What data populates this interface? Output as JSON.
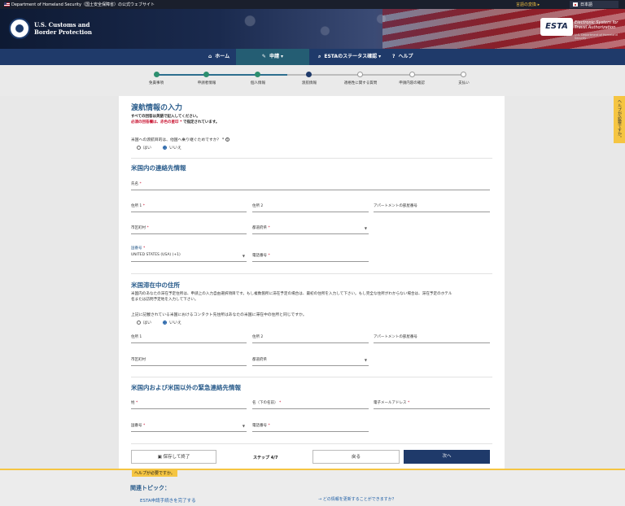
{
  "topbar": {
    "official": "Department of Homeland Security（国土安全保障省）の公式ウェブサイト",
    "change_language": "言語の変換 ▸",
    "language": "日本語"
  },
  "banner": {
    "agency_line1": "U.S. Customs and",
    "agency_line2": "Border Protection",
    "esta_logo": "ESTA",
    "esta_tagline1": "Electronic System for",
    "esta_tagline2": "Travel Authorization",
    "esta_dept": "U.S. Department of Homeland Security"
  },
  "nav": {
    "home": "ホーム",
    "apply": "申請 ▾",
    "status": "ESTAのステータス確認 ▾",
    "help": "ヘルプ"
  },
  "progress": {
    "steps": [
      "免責事項",
      "申請者情報",
      "個人情報",
      "渡航情報",
      "適格性に関する質問",
      "申請内容の確認",
      "支払い"
    ],
    "current_index": 3
  },
  "help_tab": "ヘルプが必要ですか。",
  "form": {
    "title": "渡航情報の入力",
    "note1": "すべての回答は英語で記入してください。",
    "note2_red": "必須の回答欄は、赤色の星印 *",
    "note2_rest": " で指定されています。",
    "transit_question": "米国への渡航目的は、他国へ乗り継ぐためですか？ *",
    "transit_yes": "はい",
    "transit_no": "いいえ",
    "contact_section": "米国内の連絡先情報",
    "name": "氏名",
    "address1": "住所 1",
    "address2": "住所 2",
    "apartment": "アパートメントの部屋番号",
    "city": "市区町村",
    "state": "都道府県",
    "country_code_label": "国番号",
    "country_code_value": "UNITED STATES (USA) (+1)",
    "phone": "電話番号",
    "stay_section": "米国滞在中の住所",
    "stay_para_line1": "米国内のあなたの滞在予定住所は、申請上の入力自由選択項目です。もし複数箇所に滞在予定の場合は、最初の住所を入力して下さい。もし完全な住所がわからない場合は、滞在予定のホテル",
    "stay_para_line2": "名または訪問予定地を入力して下さい。",
    "same_question": "上記に記載されている米国におけるコンタクト先住所はあなたの米国に滞在中の住所と同じですか。",
    "same_yes": "はい",
    "same_no": "いいえ",
    "stay_address1": "住所 1",
    "stay_address2": "住所 2",
    "stay_apartment": "アパートメントの部屋番号",
    "stay_city": "市区町村",
    "stay_state": "都道府県",
    "emergency_section": "米国内および米国以外の緊急連絡先情報",
    "family_name": "姓",
    "given_name": "名（下の名前）",
    "email": "電子メールアドレス",
    "em_country_code": "国番号",
    "em_phone": "電話番号",
    "save_button": "保存して終了",
    "step_text": "ステップ 4/7",
    "back_button": "戻る",
    "next_button": "次へ"
  },
  "footer": {
    "help_label": "ヘルプが必要ですか。",
    "topics": "関連トピック：",
    "link1": "ESTA申請手続きを完了する",
    "link2": "どの情報を更新することができますか？"
  },
  "colors": {
    "nav": "#1f3a6a",
    "accent_blue": "#2b5d8c",
    "required_red": "#c8102e",
    "done_green": "#2d8f6f",
    "help_yellow": "#f5c542"
  }
}
